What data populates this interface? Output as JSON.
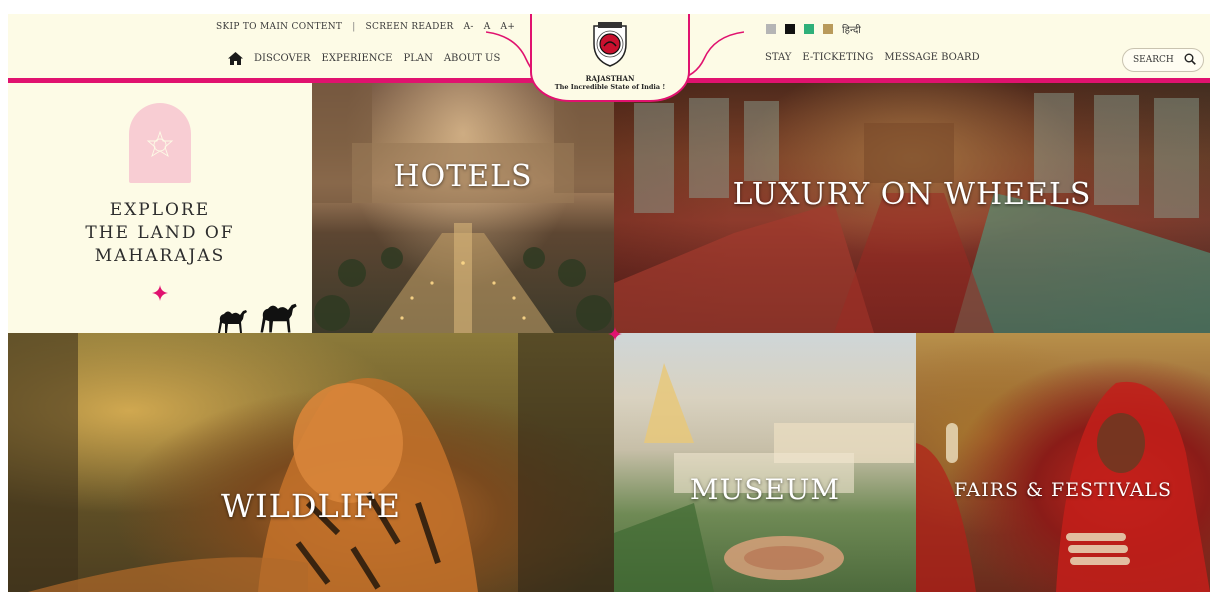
{
  "header": {
    "utility": {
      "skip": "SKIP TO MAIN CONTENT",
      "divider": "|",
      "screen_reader": "SCREEN READER",
      "font_minus": "A-",
      "font_normal": "A",
      "font_plus": "A+"
    },
    "nav_left": [
      "DISCOVER",
      "EXPERIENCE",
      "PLAN",
      "ABOUT US"
    ],
    "nav_right": [
      "STAY",
      "E-TICKETING",
      "MESSAGE BOARD"
    ],
    "theme_swatches": [
      "#b5b5b5",
      "#111111",
      "#2fb07a",
      "#b99a5b"
    ],
    "language": "हिन्दी",
    "search_label": "SEARCH",
    "brand": {
      "name": "RAJASTHAN",
      "tagline": "The Incredible State of India !"
    }
  },
  "tiles": {
    "explore": {
      "lines": [
        "EXPLORE",
        "THE LAND OF",
        "MAHARAJAS"
      ]
    },
    "hotels": "HOTELS",
    "luxury": "LUXURY ON WHEELS",
    "wildlife": "WILDLIFE",
    "museum": "MUSEUM",
    "fairs": "FAIRS & FESTIVALS"
  },
  "colors": {
    "accent": "#e0126f",
    "background": "#fdfbe6"
  }
}
